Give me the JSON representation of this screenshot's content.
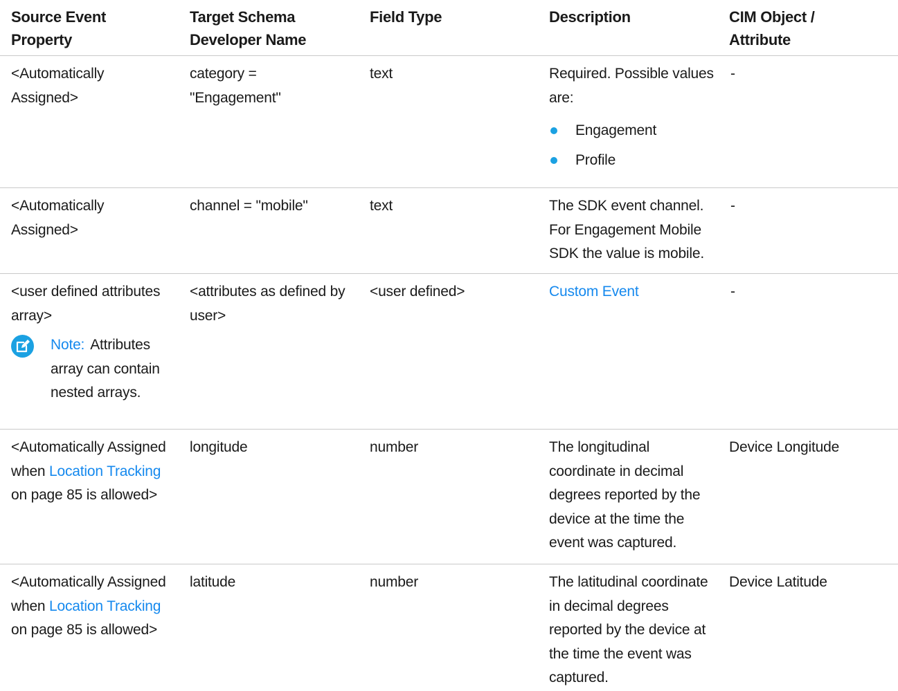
{
  "table": {
    "headers": {
      "source_line1": "Source Event",
      "source_line2": "Property",
      "target_line1": "Target Schema",
      "target_line2": "Developer Name",
      "field_type": "Field Type",
      "description": "Description",
      "cim_line1": "CIM Object /",
      "cim_line2": "Attribute"
    },
    "rows": [
      {
        "source_line1": "<Automatically",
        "source_line2": "Assigned>",
        "target_line1": "category =",
        "target_line2": "\"Engagement\"",
        "field_type": "text",
        "description_line1": "Required. Possible values",
        "description_line2": "are:",
        "bullets": [
          "Engagement",
          "Profile"
        ],
        "cim": "-"
      },
      {
        "source_line1": "<Automatically",
        "source_line2": "Assigned>",
        "target": "channel = \"mobile\"",
        "field_type": "text",
        "description_lines": [
          "The SDK event channel.",
          "For Engagement Mobile",
          "SDK the value is mobile."
        ],
        "cim": "-"
      },
      {
        "source_line1": "<user defined attributes",
        "source_line2": "array>",
        "note_label": "Note:",
        "note_line1": "Attributes",
        "note_line2": "array can contain",
        "note_line3": "nested arrays.",
        "target_line1": "<attributes as defined by",
        "target_line2": "user>",
        "field_type": "<user defined>",
        "description_link": "Custom Event",
        "cim": "-"
      },
      {
        "source_line1": "<Automatically Assigned",
        "source_prefix": "when ",
        "source_link": "Location Tracking",
        "source_line3": "on page 85 is allowed>",
        "target": "longitude",
        "field_type": "number",
        "description_lines": [
          "The longitudinal",
          "coordinate in decimal",
          "degrees reported by the",
          "device at the time the",
          "event was captured."
        ],
        "cim": "Device Longitude"
      },
      {
        "source_line1": "<Automatically Assigned",
        "source_prefix": "when ",
        "source_link": "Location Tracking",
        "source_line3": "on page 85 is allowed>",
        "target": "latitude",
        "field_type": "number",
        "description_lines": [
          "The latitudinal coordinate",
          "in decimal degrees",
          "reported by the device at",
          "the time the event was",
          "captured."
        ],
        "cim": "Device Latitude"
      }
    ]
  },
  "icons": {
    "note": "edit-note-icon"
  },
  "colors": {
    "link": "#1589ee",
    "bullet": "#1ba1e2",
    "note_icon": "#1ba1e2",
    "rule": "#c9c9c9"
  }
}
